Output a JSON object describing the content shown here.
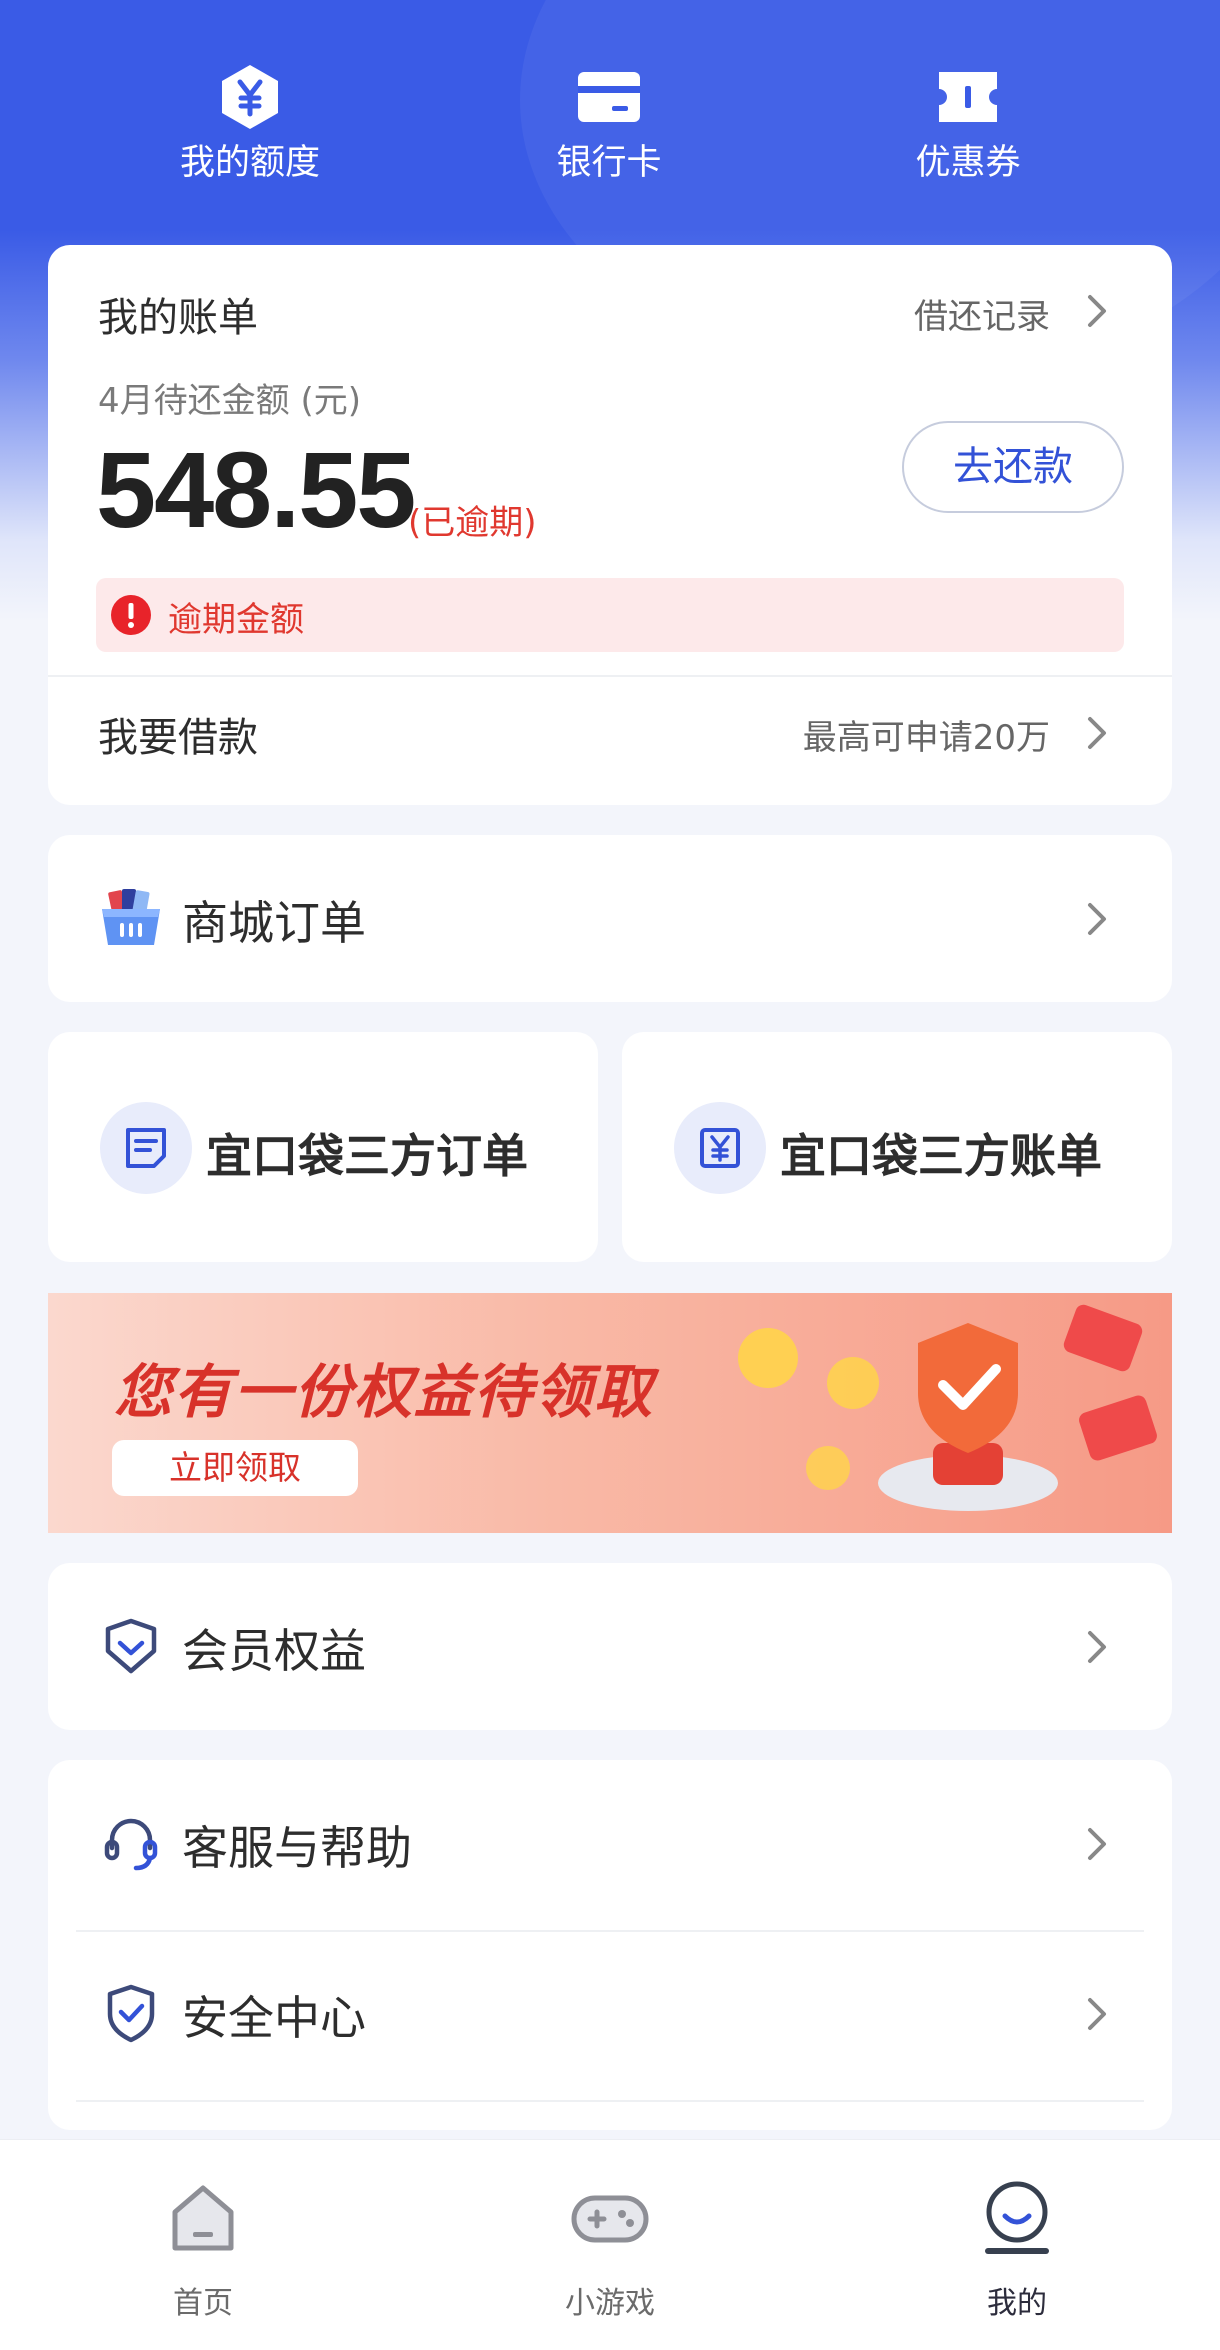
{
  "quick_nav": [
    {
      "label": "我的额度",
      "icon": "yuan-hexagon-icon"
    },
    {
      "label": "银行卡",
      "icon": "bank-card-icon"
    },
    {
      "label": "优惠券",
      "icon": "coupon-icon"
    }
  ],
  "bill": {
    "title": "我的账单",
    "record_link": "借还记录",
    "due_label": "4月待还金额 (元)",
    "amount": "548.55",
    "overdue_tag": "(已逾期)",
    "repay_button": "去还款",
    "alert_text": "逾期金额",
    "borrow_label": "我要借款",
    "borrow_hint": "最高可申请20万"
  },
  "mall_order": {
    "label": "商城订单"
  },
  "third_party": {
    "orders_label": "宜口袋三方订单",
    "bills_label": "宜口袋三方账单"
  },
  "banner": {
    "headline": "您有一份权益待领取",
    "cta": "立即领取"
  },
  "member": {
    "label": "会员权益"
  },
  "service": {
    "help_label": "客服与帮助",
    "security_label": "安全中心"
  },
  "tabbar": [
    {
      "label": "首页",
      "icon": "home-icon"
    },
    {
      "label": "小游戏",
      "icon": "gamepad-icon"
    },
    {
      "label": "我的",
      "icon": "profile-icon",
      "active": true
    }
  ],
  "colors": {
    "brand_blue": "#3a5be6",
    "alert_red": "#e0382f",
    "alert_bg": "#fde9ea",
    "page_bg": "#f3f5fb"
  }
}
